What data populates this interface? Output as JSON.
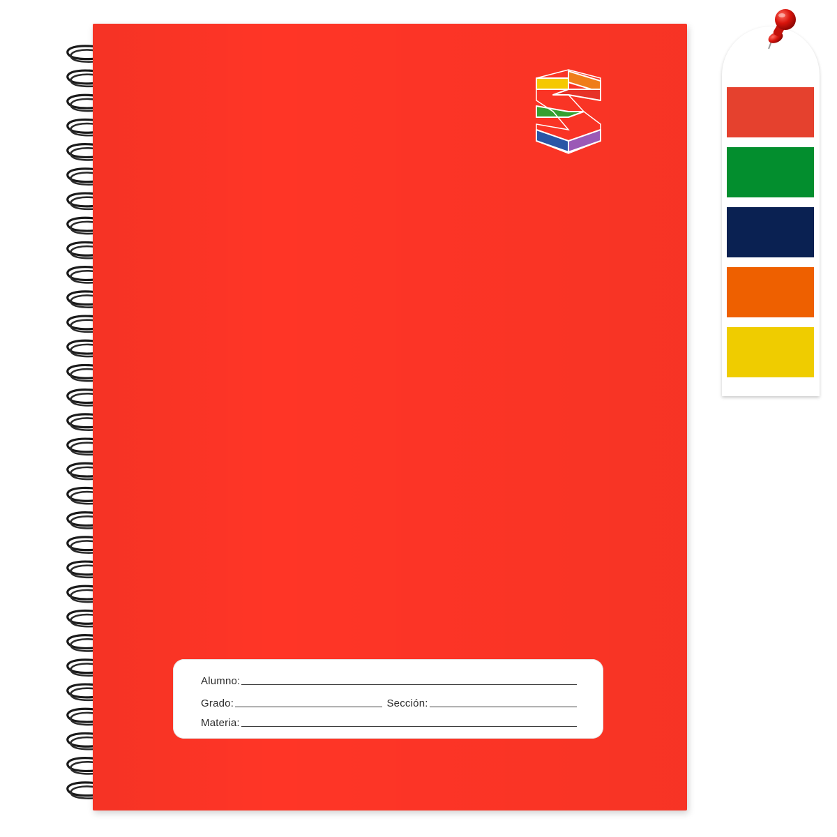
{
  "notebook": {
    "cover_color": "#ff3526",
    "binding": "black wire spiral",
    "logo": {
      "icon": "hexagonal-s-logo-icon",
      "colors": [
        "#f5c800",
        "#ef7d1a",
        "#e63228",
        "#34a030",
        "#2a56a6",
        "#9b59b6"
      ]
    },
    "label": {
      "alumno": "Alumno:",
      "grado": "Grado:",
      "seccion": "Sección:",
      "materia": "Materia:"
    }
  },
  "color_options": {
    "pin_icon": "push-pin-icon",
    "swatches": [
      {
        "name": "red",
        "color": "#e5412e"
      },
      {
        "name": "green",
        "color": "#038e2e"
      },
      {
        "name": "navy",
        "color": "#0a2152"
      },
      {
        "name": "orange",
        "color": "#ee6000"
      },
      {
        "name": "yellow",
        "color": "#efcc00"
      }
    ]
  }
}
